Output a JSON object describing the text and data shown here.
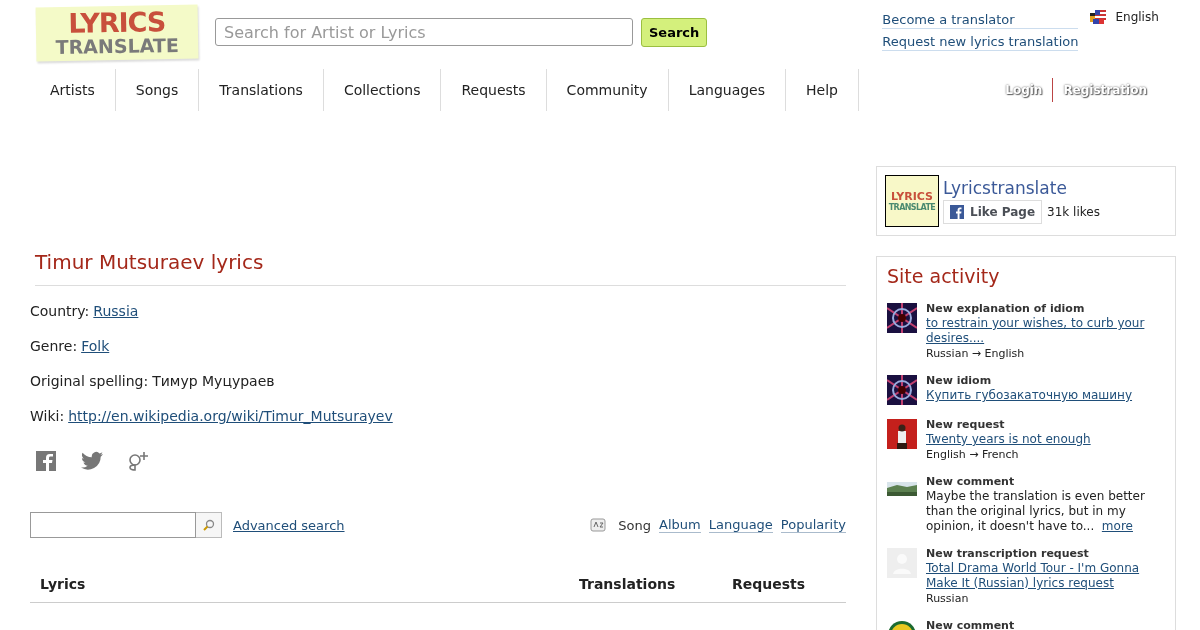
{
  "logo": {
    "line1": "LYRICS",
    "line2": "TRANSLATE"
  },
  "search": {
    "placeholder": "Search for Artist or Lyrics",
    "button": "Search"
  },
  "top_links": [
    "Become a translator",
    "Request new lyrics translation"
  ],
  "language": "English",
  "nav": [
    "Artists",
    "Songs",
    "Translations",
    "Collections",
    "Requests",
    "Community",
    "Languages",
    "Help"
  ],
  "auth": [
    "Login",
    "Registration"
  ],
  "artist": {
    "title": "Timur Mutsuraev lyrics",
    "facts": [
      {
        "label": "Country:",
        "value": "Russia",
        "link": true
      },
      {
        "label": "Genre:",
        "value": "Folk",
        "link": true
      },
      {
        "label": "Original spelling:",
        "value": "Тимур Муцураев",
        "link": false
      },
      {
        "label": "Wiki:",
        "value": "http://en.wikipedia.org/wiki/Timur_Mutsurayev",
        "link": true
      }
    ]
  },
  "filter": {
    "advanced": "Advanced search",
    "sort": [
      {
        "label": "Song",
        "selected": true
      },
      {
        "label": "Album",
        "selected": false
      },
      {
        "label": "Language",
        "selected": false
      },
      {
        "label": "Popularity",
        "selected": false
      }
    ]
  },
  "table": {
    "columns": [
      "Lyrics",
      "Translations",
      "Requests"
    ]
  },
  "fb_box": {
    "name": "Lyricstranslate",
    "logo1": "LYRICS",
    "logo2": "TRANSLATE",
    "like": "Like Page",
    "likes": "31k likes"
  },
  "activity": {
    "title": "Site activity",
    "items": [
      {
        "kind": "burst",
        "title": "New explanation of idiom",
        "link": "to restrain your wishes, to curb your desires....",
        "note": "Russian → English"
      },
      {
        "kind": "burst",
        "title": "New idiom",
        "link": "Купить губозакаточную машину"
      },
      {
        "kind": "person",
        "title": "New request",
        "link": "Twenty years is not enough",
        "note": "English → French"
      },
      {
        "kind": "landscape",
        "title": "New comment",
        "text": "Maybe the translation is even better than the original lyrics, but in my opinion, it doesn't have to...",
        "more": "more"
      },
      {
        "kind": "blank",
        "title": "New transcription request",
        "link": "Total Drama World Tour - I'm Gonna Make It (Russian) lyrics request",
        "note": "Russian"
      },
      {
        "kind": "badge",
        "title": "New comment"
      }
    ]
  }
}
